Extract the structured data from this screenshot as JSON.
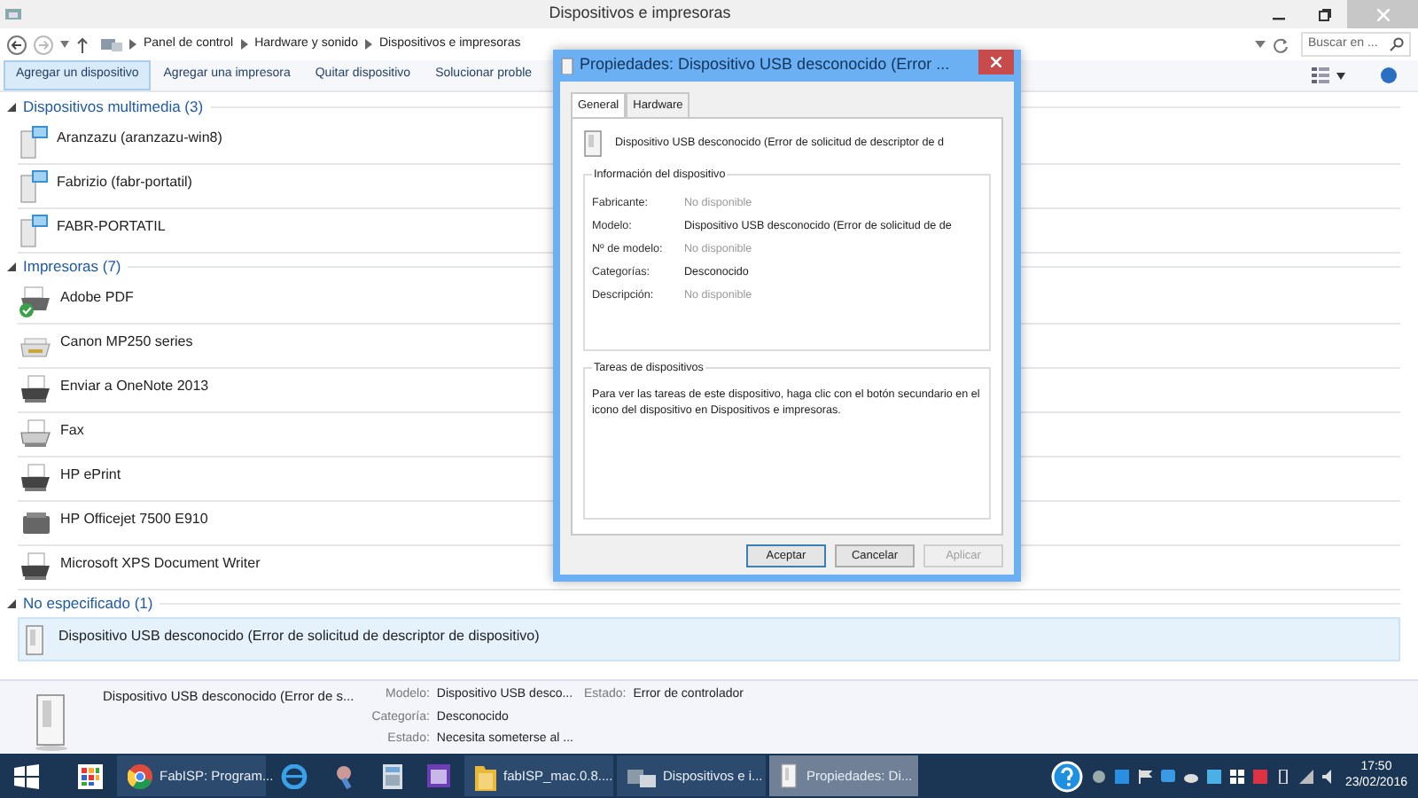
{
  "window": {
    "title": "Dispositivos e impresoras"
  },
  "address_bar": {
    "path": [
      "Panel de control",
      "Hardware y sonido",
      "Dispositivos e impresoras"
    ],
    "search_placeholder": "Buscar en ..."
  },
  "toolbar": {
    "buttons": [
      {
        "label": "Agregar un dispositivo",
        "selected": true
      },
      {
        "label": "Agregar una impresora",
        "selected": false
      },
      {
        "label": "Quitar dispositivo",
        "selected": false
      },
      {
        "label": "Solucionar proble",
        "selected": false
      }
    ]
  },
  "groups": [
    {
      "title": "Dispositivos multimedia (3)",
      "expanded": true,
      "devices": [
        {
          "name": "Aranzazu (aranzazu-win8)",
          "kind": "computer",
          "selected": false
        },
        {
          "name": "Fabrizio (fabr-portatil)",
          "kind": "computer",
          "selected": false
        },
        {
          "name": "FABR-PORTATIL",
          "kind": "computer",
          "selected": false
        }
      ]
    },
    {
      "title": "Impresoras (7)",
      "expanded": true,
      "devices": [
        {
          "name": "Adobe PDF",
          "kind": "default-printer",
          "selected": false
        },
        {
          "name": "Canon MP250 series",
          "kind": "scanner-printer",
          "selected": false
        },
        {
          "name": "Enviar a OneNote 2013",
          "kind": "printer",
          "selected": false
        },
        {
          "name": "Fax",
          "kind": "fax",
          "selected": false
        },
        {
          "name": "HP ePrint",
          "kind": "printer",
          "selected": false
        },
        {
          "name": "HP Officejet 7500 E910",
          "kind": "office-printer",
          "selected": false
        },
        {
          "name": "Microsoft XPS Document Writer",
          "kind": "printer",
          "selected": false
        }
      ]
    },
    {
      "title": "No especificado (1)",
      "expanded": true,
      "devices": [
        {
          "name": "Dispositivo USB desconocido (Error de solicitud de descriptor de dispositivo)",
          "kind": "usb",
          "selected": true
        }
      ]
    }
  ],
  "details": {
    "name": "Dispositivo USB desconocido (Error de s...",
    "columns": [
      [
        {
          "label": "Modelo:",
          "value": "Dispositivo USB desco..."
        },
        {
          "label": "Categoría:",
          "value": "Desconocido"
        },
        {
          "label": "Estado:",
          "value": "Necesita someterse al ..."
        }
      ],
      [
        {
          "label": "Estado:",
          "value": "Error de controlador"
        }
      ]
    ]
  },
  "dialog": {
    "title": "Propiedades: Dispositivo USB desconocido (Error ...",
    "tabs": [
      {
        "label": "General",
        "selected": true
      },
      {
        "label": "Hardware",
        "selected": false
      }
    ],
    "device_name": "Dispositivo USB desconocido (Error de solicitud de descriptor de d",
    "info_title": "Información del dispositivo",
    "info": [
      {
        "label": "Fabricante:",
        "value": "No disponible",
        "available": false
      },
      {
        "label": "Modelo:",
        "value": "Dispositivo USB desconocido (Error de solicitud de de",
        "available": true
      },
      {
        "label": "Nº de modelo:",
        "value": "No disponible",
        "available": false
      },
      {
        "label": "Categorías:",
        "value": "Desconocido",
        "available": true
      },
      {
        "label": "Descripción:",
        "value": "No disponible",
        "available": false
      }
    ],
    "tasks_title": "Tareas de dispositivos",
    "tasks_text": "Para ver las tareas de este dispositivo, haga clic con el botón secundario en el icono del dispositivo en Dispositivos e impresoras.",
    "buttons": [
      {
        "label": "Aceptar",
        "default": true,
        "disabled": false
      },
      {
        "label": "Cancelar",
        "default": false,
        "disabled": false
      },
      {
        "label": "Aplicar",
        "default": false,
        "disabled": true
      }
    ]
  },
  "taskbar": {
    "items": [
      {
        "kind": "start",
        "active": false
      },
      {
        "kind": "apps",
        "active": false
      },
      {
        "kind": "browser",
        "label": "FabISP: Program...",
        "active": false
      },
      {
        "kind": "globe",
        "active": false
      },
      {
        "kind": "tool",
        "active": false
      },
      {
        "kind": "calculator",
        "active": false
      },
      {
        "kind": "calendar",
        "active": false
      },
      {
        "kind": "folder",
        "label": "fabISP_mac.0.8....",
        "active": false
      },
      {
        "kind": "devices",
        "label": "Dispositivos e i...",
        "active": false
      },
      {
        "kind": "usb",
        "label": "Propiedades: Di...",
        "active": true
      }
    ],
    "clock": {
      "time": "17:50",
      "date": "23/02/2016"
    }
  }
}
